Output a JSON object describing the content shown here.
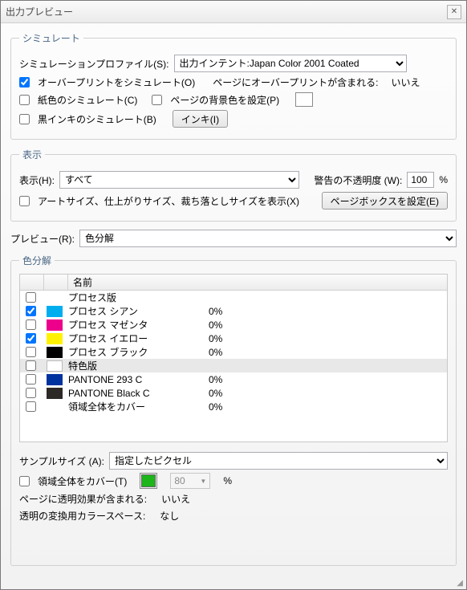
{
  "title": "出力プレビュー",
  "simulate": {
    "legend": "シミュレート",
    "profile_label": "シミュレーションプロファイル(S):",
    "profile_value": "出力インテント:Japan Color 2001 Coated",
    "overprint_label": "オーバープリントをシミュレート(O)",
    "overprint_info_label": "ページにオーバープリントが含まれる:",
    "overprint_info_value": "いいえ",
    "paper_label": "紙色のシミュレート(C)",
    "bgcolor_label": "ページの背景色を設定(P)",
    "blackink_label": "黒インキのシミュレート(B)",
    "ink_button": "インキ(I)"
  },
  "display": {
    "legend": "表示",
    "show_label": "表示(H):",
    "show_value": "すべて",
    "warn_label": "警告の不透明度 (W):",
    "warn_value": "100",
    "percent": "%",
    "artsize_label": "アートサイズ、仕上がりサイズ、裁ち落としサイズを表示(X)",
    "pagebox_button": "ページボックスを設定(E)"
  },
  "preview": {
    "label": "プレビュー(R):",
    "value": "色分解"
  },
  "separations": {
    "legend": "色分解",
    "name_header": "名前",
    "rows": [
      {
        "checked": false,
        "swatch": null,
        "name": "プロセス版",
        "value": "",
        "highlight": false
      },
      {
        "checked": true,
        "swatch": "#00aeef",
        "name": "プロセス シアン",
        "value": "0%",
        "highlight": false
      },
      {
        "checked": false,
        "swatch": "#ec008c",
        "name": "プロセス マゼンタ",
        "value": "0%",
        "highlight": false
      },
      {
        "checked": true,
        "swatch": "#fff200",
        "name": "プロセス イエロー",
        "value": "0%",
        "highlight": false
      },
      {
        "checked": false,
        "swatch": "#000000",
        "name": "プロセス ブラック",
        "value": "0%",
        "highlight": false
      },
      {
        "checked": false,
        "swatch": null,
        "name": "特色版",
        "value": "",
        "highlight": true
      },
      {
        "checked": false,
        "swatch": "#0033a0",
        "name": "PANTONE 293 C",
        "value": "0%",
        "highlight": false
      },
      {
        "checked": false,
        "swatch": "#2d2926",
        "name": "PANTONE Black C",
        "value": "0%",
        "highlight": false
      },
      {
        "checked": false,
        "swatch": null,
        "name": "領域全体をカバー",
        "value": "0%",
        "highlight": false
      }
    ]
  },
  "bottom": {
    "sample_label": "サンプルサイズ (A):",
    "sample_value": "指定したピクセル",
    "cover_label": "領域全体をカバー(T)",
    "cover_value": "80",
    "percent": "%",
    "trans_label": "ページに透明効果が含まれる:",
    "trans_value": "いいえ",
    "blend_label": "透明の変換用カラースペース:",
    "blend_value": "なし"
  }
}
